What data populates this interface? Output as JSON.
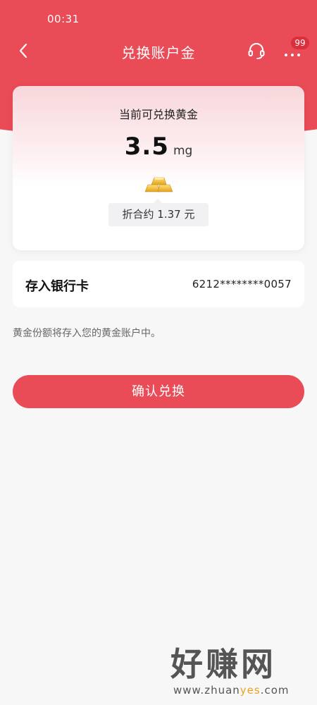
{
  "status_bar": {
    "time": "00:31"
  },
  "nav": {
    "title": "兑换账户金",
    "badge": "99",
    "back_icon": "chevron-left-icon",
    "service_icon": "headset-icon",
    "more_icon": "more-dots-icon"
  },
  "gold_card": {
    "caption": "当前可兑换黄金",
    "amount": "3.5",
    "unit": "mg",
    "approx_prefix": "折合约",
    "approx_value": "1.37",
    "approx_currency": "元",
    "icon": "gold-bars-icon"
  },
  "bank": {
    "label": "存入银行卡",
    "card_number": "6212********0057"
  },
  "note": "黄金份额将存入您的黄金账户中。",
  "confirm_button": "确认兑换",
  "watermark": {
    "title": "好赚网",
    "site_prefix": "www.zhuan",
    "site_highlight": "yes",
    "site_suffix": ".com"
  },
  "colors": {
    "brand": "#e94b57",
    "badge": "#d9303c",
    "page_bg": "#f7f7f8"
  }
}
